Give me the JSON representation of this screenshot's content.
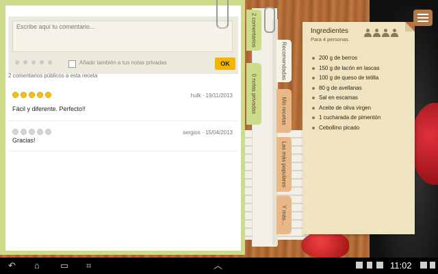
{
  "comments_panel": {
    "input_placeholder": "Escribe aquí tu comentario...",
    "private_notes_label": "Añadir también a tus notas privadas",
    "ok_label": "OK",
    "public_count": "2 comentarios públicos a esta receta",
    "comments": [
      {
        "author_date": "hulk · 19/11/2013",
        "text": "Fácil y diferente. Perfecto!!",
        "rating": 5
      },
      {
        "author_date": "sergios · 15/04/2013",
        "text": "Gracias!",
        "rating": 0
      }
    ]
  },
  "tabs": {
    "comments": "2 comentarios",
    "private_notes": "0 notas privadas",
    "recommended": "Recomendadas",
    "my_recipes": "Mis recetas",
    "popular": "Las más populares",
    "more": "Y más..."
  },
  "ingredients": {
    "title": "Ingredientes",
    "servings": "Para 4 personas",
    "items": [
      "200 g de berros",
      "150 g de lacón en lascas",
      "100 g de queso de tetilla",
      "80 g de avellanas",
      "Sal en escamas",
      "Aceite de oliva virgen",
      "1 cucharada de pimentón",
      "Cebollino picado"
    ]
  },
  "system_bar": {
    "time": "11:02",
    "nav_back": "↶",
    "nav_home": "⌂",
    "nav_recent": "▭",
    "nav_screenshot": "⌗",
    "nav_up": "︿"
  }
}
